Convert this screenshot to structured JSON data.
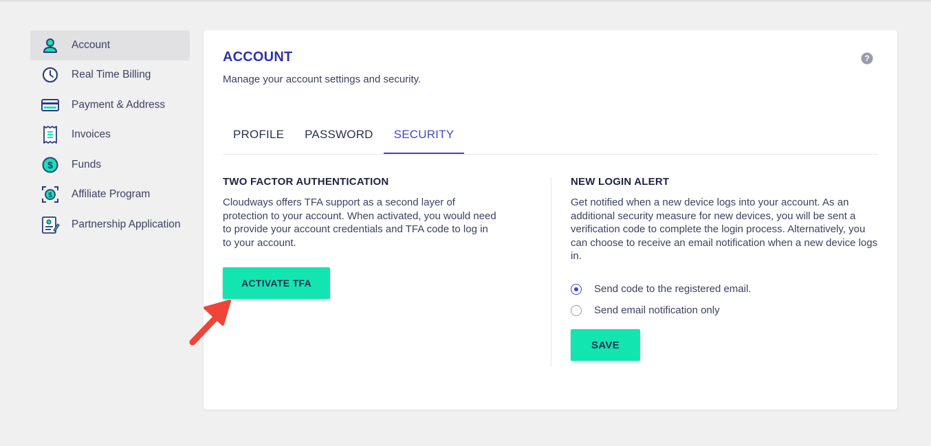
{
  "sidebar": {
    "items": [
      {
        "label": "Account",
        "icon": "user-icon",
        "active": true
      },
      {
        "label": "Real Time Billing",
        "icon": "clock-icon"
      },
      {
        "label": "Payment & Address",
        "icon": "credit-card-icon"
      },
      {
        "label": "Invoices",
        "icon": "receipt-icon"
      },
      {
        "label": "Funds",
        "icon": "dollar-circle-icon"
      },
      {
        "label": "Affiliate Program",
        "icon": "affiliate-icon"
      },
      {
        "label": "Partnership Application",
        "icon": "partnership-document-icon"
      }
    ]
  },
  "main": {
    "title": "ACCOUNT",
    "subtitle": "Manage your account settings and security.",
    "help_icon": "question-circle-icon",
    "tabs": [
      {
        "label": "PROFILE"
      },
      {
        "label": "PASSWORD"
      },
      {
        "label": "SECURITY",
        "active": true
      }
    ],
    "tfa": {
      "title": "TWO FACTOR AUTHENTICATION",
      "text": "Cloudways offers TFA support as a second layer of protection to your account. When activated, you would need to provide your account credentials and TFA code to log in to your account.",
      "button": "ACTIVATE TFA"
    },
    "login_alert": {
      "title": "NEW LOGIN ALERT",
      "text": "Get notified when a new device logs into your account. As an additional security measure for new devices, you will be sent a verification code to complete the login process. Alternatively, you can choose to receive an email notification when a new device logs in.",
      "options": [
        {
          "label": "Send code to the registered email.",
          "selected": true
        },
        {
          "label": "Send email notification only",
          "selected": false
        }
      ],
      "button": "SAVE"
    }
  },
  "colors": {
    "accent": "#13e5b0",
    "primary": "#3f48c8",
    "annotation_arrow": "#ef4437"
  }
}
